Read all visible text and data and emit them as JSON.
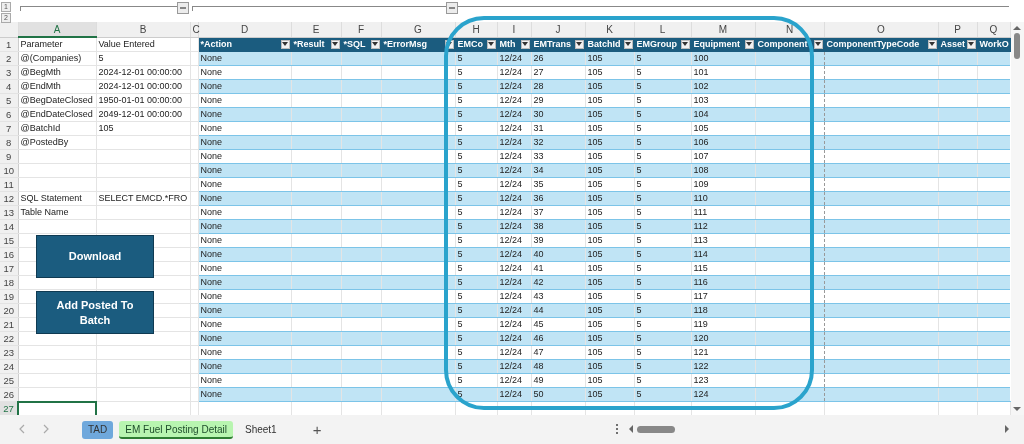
{
  "outline": {
    "levels": [
      "1",
      "2"
    ]
  },
  "column_letters": [
    {
      "label": "A",
      "selected": true
    },
    {
      "label": "B",
      "selected": false
    },
    {
      "label": "C",
      "selected": false
    },
    {
      "label": "D",
      "selected": false
    },
    {
      "label": "E",
      "selected": false
    },
    {
      "label": "F",
      "selected": false
    },
    {
      "label": "G",
      "selected": false
    },
    {
      "label": "H",
      "selected": false
    },
    {
      "label": "I",
      "selected": false
    },
    {
      "label": "J",
      "selected": false
    },
    {
      "label": "K",
      "selected": false
    },
    {
      "label": "L",
      "selected": false
    },
    {
      "label": "M",
      "selected": false
    },
    {
      "label": "N",
      "selected": false
    },
    {
      "label": "O",
      "selected": false
    },
    {
      "label": "P",
      "selected": false
    },
    {
      "label": "Q",
      "selected": false
    }
  ],
  "row_numbers": [
    {
      "label": "1",
      "selected": false
    },
    {
      "label": "2",
      "selected": false
    },
    {
      "label": "3",
      "selected": false
    },
    {
      "label": "4",
      "selected": false
    },
    {
      "label": "5",
      "selected": false
    },
    {
      "label": "6",
      "selected": false
    },
    {
      "label": "7",
      "selected": false
    },
    {
      "label": "8",
      "selected": false
    },
    {
      "label": "9",
      "selected": false
    },
    {
      "label": "10",
      "selected": false
    },
    {
      "label": "11",
      "selected": false
    },
    {
      "label": "12",
      "selected": false
    },
    {
      "label": "13",
      "selected": false
    },
    {
      "label": "14",
      "selected": false
    },
    {
      "label": "15",
      "selected": false
    },
    {
      "label": "16",
      "selected": false
    },
    {
      "label": "17",
      "selected": false
    },
    {
      "label": "18",
      "selected": false
    },
    {
      "label": "19",
      "selected": false
    },
    {
      "label": "20",
      "selected": false
    },
    {
      "label": "21",
      "selected": false
    },
    {
      "label": "22",
      "selected": false
    },
    {
      "label": "23",
      "selected": false
    },
    {
      "label": "24",
      "selected": false
    },
    {
      "label": "25",
      "selected": false
    },
    {
      "label": "26",
      "selected": false
    },
    {
      "label": "27",
      "selected": true
    }
  ],
  "parameters": [
    {
      "label": "Parameter",
      "value": "Value Entered"
    },
    {
      "label": "@(Companies)",
      "value": "5"
    },
    {
      "label": "@BegMth",
      "value": "2024-12-01 00:00:00"
    },
    {
      "label": "@EndMth",
      "value": "2024-12-01 00:00:00"
    },
    {
      "label": "@BegDateClosed",
      "value": "1950-01-01 00:00:00"
    },
    {
      "label": "@EndDateClosed",
      "value": "2049-12-01 00:00:00"
    },
    {
      "label": "@BatchId",
      "value": "105"
    },
    {
      "label": "@PostedBy"
    }
  ],
  "extra_fields": [
    {
      "label": "SQL Statement",
      "value": "SELECT EMCD.*FRO"
    },
    {
      "label": "Table Name"
    }
  ],
  "table": {
    "columns": [
      {
        "label": "*Action",
        "filter_button": true
      },
      {
        "label": "*Result",
        "filter_button": true
      },
      {
        "label": "*SQL",
        "filter_button": true
      },
      {
        "label": "*ErrorMsg",
        "filter_button": true
      },
      {
        "label": "EMCo",
        "filter_button": true
      },
      {
        "label": "Mth",
        "filter_button": true
      },
      {
        "label": "EMTrans",
        "filter_button": true
      },
      {
        "label": "BatchId",
        "filter_button": true
      },
      {
        "label": "EMGroup",
        "filter_button": true
      },
      {
        "label": "Equipment",
        "filter_button": true
      },
      {
        "label": "Component",
        "filter_button": true
      },
      {
        "label": "ComponentTypeCode",
        "filter_button": true
      },
      {
        "label": "Asset",
        "filter_button": true
      },
      {
        "label": "WorkO",
        "filter_button": false
      }
    ],
    "rows": [
      {
        "action": "None",
        "emco": "5",
        "mth": "12/24",
        "emtrans": "26",
        "batch_id": "105",
        "emgroup": "5",
        "equipment": "100"
      },
      {
        "action": "None",
        "emco": "5",
        "mth": "12/24",
        "emtrans": "27",
        "batch_id": "105",
        "emgroup": "5",
        "equipment": "101"
      },
      {
        "action": "None",
        "emco": "5",
        "mth": "12/24",
        "emtrans": "28",
        "batch_id": "105",
        "emgroup": "5",
        "equipment": "102"
      },
      {
        "action": "None",
        "emco": "5",
        "mth": "12/24",
        "emtrans": "29",
        "batch_id": "105",
        "emgroup": "5",
        "equipment": "103"
      },
      {
        "action": "None",
        "emco": "5",
        "mth": "12/24",
        "emtrans": "30",
        "batch_id": "105",
        "emgroup": "5",
        "equipment": "104"
      },
      {
        "action": "None",
        "emco": "5",
        "mth": "12/24",
        "emtrans": "31",
        "batch_id": "105",
        "emgroup": "5",
        "equipment": "105"
      },
      {
        "action": "None",
        "emco": "5",
        "mth": "12/24",
        "emtrans": "32",
        "batch_id": "105",
        "emgroup": "5",
        "equipment": "106"
      },
      {
        "action": "None",
        "emco": "5",
        "mth": "12/24",
        "emtrans": "33",
        "batch_id": "105",
        "emgroup": "5",
        "equipment": "107"
      },
      {
        "action": "None",
        "emco": "5",
        "mth": "12/24",
        "emtrans": "34",
        "batch_id": "105",
        "emgroup": "5",
        "equipment": "108"
      },
      {
        "action": "None",
        "emco": "5",
        "mth": "12/24",
        "emtrans": "35",
        "batch_id": "105",
        "emgroup": "5",
        "equipment": "109"
      },
      {
        "action": "None",
        "emco": "5",
        "mth": "12/24",
        "emtrans": "36",
        "batch_id": "105",
        "emgroup": "5",
        "equipment": "110"
      },
      {
        "action": "None",
        "emco": "5",
        "mth": "12/24",
        "emtrans": "37",
        "batch_id": "105",
        "emgroup": "5",
        "equipment": "111"
      },
      {
        "action": "None",
        "emco": "5",
        "mth": "12/24",
        "emtrans": "38",
        "batch_id": "105",
        "emgroup": "5",
        "equipment": "112"
      },
      {
        "action": "None",
        "emco": "5",
        "mth": "12/24",
        "emtrans": "39",
        "batch_id": "105",
        "emgroup": "5",
        "equipment": "113"
      },
      {
        "action": "None",
        "emco": "5",
        "mth": "12/24",
        "emtrans": "40",
        "batch_id": "105",
        "emgroup": "5",
        "equipment": "114"
      },
      {
        "action": "None",
        "emco": "5",
        "mth": "12/24",
        "emtrans": "41",
        "batch_id": "105",
        "emgroup": "5",
        "equipment": "115"
      },
      {
        "action": "None",
        "emco": "5",
        "mth": "12/24",
        "emtrans": "42",
        "batch_id": "105",
        "emgroup": "5",
        "equipment": "116"
      },
      {
        "action": "None",
        "emco": "5",
        "mth": "12/24",
        "emtrans": "43",
        "batch_id": "105",
        "emgroup": "5",
        "equipment": "117"
      },
      {
        "action": "None",
        "emco": "5",
        "mth": "12/24",
        "emtrans": "44",
        "batch_id": "105",
        "emgroup": "5",
        "equipment": "118"
      },
      {
        "action": "None",
        "emco": "5",
        "mth": "12/24",
        "emtrans": "45",
        "batch_id": "105",
        "emgroup": "5",
        "equipment": "119"
      },
      {
        "action": "None",
        "emco": "5",
        "mth": "12/24",
        "emtrans": "46",
        "batch_id": "105",
        "emgroup": "5",
        "equipment": "120"
      },
      {
        "action": "None",
        "emco": "5",
        "mth": "12/24",
        "emtrans": "47",
        "batch_id": "105",
        "emgroup": "5",
        "equipment": "121"
      },
      {
        "action": "None",
        "emco": "5",
        "mth": "12/24",
        "emtrans": "48",
        "batch_id": "105",
        "emgroup": "5",
        "equipment": "122"
      },
      {
        "action": "None",
        "emco": "5",
        "mth": "12/24",
        "emtrans": "49",
        "batch_id": "105",
        "emgroup": "5",
        "equipment": "123"
      },
      {
        "action": "None",
        "emco": "5",
        "mth": "12/24",
        "emtrans": "50",
        "batch_id": "105",
        "emgroup": "5",
        "equipment": "124"
      }
    ]
  },
  "buttons": [
    "Download",
    "Add Posted To Batch"
  ],
  "sheet_tabs": [
    {
      "label": "TAD",
      "selected": false,
      "color": "#6fa8dc"
    },
    {
      "label": "EM Fuel Posting Detail",
      "selected": true,
      "color": "#b8f5b0"
    },
    {
      "label": "Sheet1",
      "selected": false
    }
  ],
  "add_sheet": "+"
}
